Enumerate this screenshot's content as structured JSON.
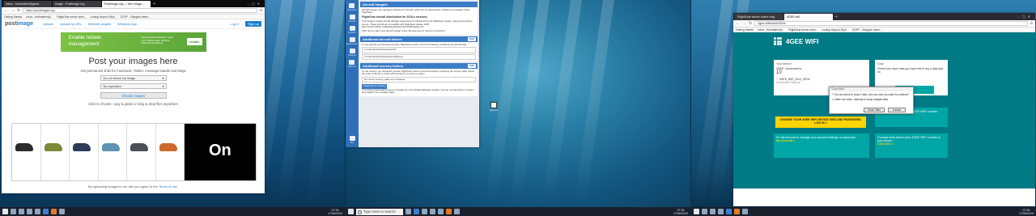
{
  "screen1": {
    "tabs": [
      "Inbox - fredmather@gmai...",
      "Image - Postimage.org",
      "Postimage.org — free image...",
      "+"
    ],
    "url": "https://postimages.org",
    "bookmarks": [
      "Getting Started",
      "Inbox - fredmather@...",
      "FlightGear server onlin...",
      "Lookup Airport | Biyli...",
      "EGPF - Glasgow Intern..."
    ],
    "header": {
      "logo_a": "post",
      "logo_b": "image",
      "nav": [
        "Upload",
        "Upload by URL",
        "Website plugins",
        "Windows App"
      ],
      "login": "Log in",
      "signup": "Sign up"
    },
    "ad": {
      "headline": "Enable rebate management",
      "body": "Cloud-hosted software. Track your rebate deals. Achieve financial compliance.",
      "brand": "enable"
    },
    "title": "Post your images here",
    "subtitle": "Get permanent links for Facebook, Twitter, message boards and blogs",
    "resize": "Do not resize my image",
    "expiry": "No expiration",
    "choose": "Choose images",
    "hint": "Click to choose, copy & paste or drag & drop files anywhere",
    "brand_logo": "On",
    "footer_a": "By uploading images to our site you agree to the",
    "footer_b": "Terms of use."
  },
  "screen2": {
    "sidebar": [
      "Summary",
      "Aircraft",
      "Location",
      "Environment",
      "Settings",
      "Add-ons"
    ],
    "sidebar_bottom": "Fly!",
    "aircraft": {
      "header": "Aircraft hangars",
      "intro": "Aircraft hangars are managed collections of aircraft, which can be downloaded, installed and updated inside FlightGear.",
      "dist_title": "FlightGear aircraft distribution for 2018.x versions",
      "dist_text": "This hangar includes aircraft officially supported and maintained by the FlightGear project, using a hand-drawn license. These aircraft are compatible with FlightGear release 2018.",
      "dist_url": "http://mirrors.ibiblio.org/flightgear/ftp/Aircraft-2018/catalog.xml",
      "dist_hint": "Click here to add a new aircraft hangar. (Note this assumes an Internet connection)"
    },
    "folders": {
      "header": "Additional aircraft folders",
      "add": "Add",
      "text": "To use aircraft you download yourself, FlightGear needs to know the folder(s) containing the aircraft data.",
      "paths": [
        "C:/Users/fredm/Desktop/aircraft",
        "C:/Users/fredm/Desktop/Aircraft/Navys"
      ]
    },
    "scenery": {
      "header": "Additional scenery folders",
      "add": "Add",
      "text": "To use scenery you download yourself, FlightGear needs to know the folders containing the scenery data. Adjust the order of the list to control which scenery is used in a region.",
      "none": "No custom scenery paths are configured.",
      "install_btn": "Install add-on scenery",
      "install_text": "If you have downloaded scenery manually from the official FlightGear website, you can use this button to extract and install it into a suitable folder."
    },
    "desktop_icon": "fgfs.exe",
    "search_placeholder": "Type here to search"
  },
  "screen3": {
    "tabs": [
      "FlightGear server online map",
      "4GEE wifi",
      "+"
    ],
    "url": "4gee.wifi/web/#/4Gee",
    "bookmarks": [
      "Getting Started",
      "Inbox - fredmather@...",
      "FlightGear server onlin...",
      "Lookup Airport | Biyli...",
      "EGPF - Glasgow Intern..."
    ],
    "logo": "4GEE WIFI",
    "device": {
      "title": "Your device",
      "name": "4GEE",
      "connected_label": "Connected to:",
      "connected_count": "10",
      "network": "4GEE_WiFi_3414_5GHz",
      "sub": "Connected Devices:"
    },
    "data": {
      "title": "Data",
      "text": "Check how much data you have left or buy a data add-on",
      "cta": "CK HERE >"
    },
    "change_ssid": "CHANGE YOUR 4GEE WIFI DEVICE SSID AND PASSWORD. LOG IN >",
    "sms_top": "Forward texts sent to your 4GEE WIFI number.",
    "account": {
      "text": "Do My Account to manage your account settings or payments.",
      "link": "My Account >"
    },
    "forward": {
      "text": "Forward texts sent to your 4GEE WIFI number to your phone.",
      "link": "Click here >"
    },
    "dialog": {
      "title": "Close tabs?",
      "text": "You are about to close 2 tabs. Are you sure you want to continue?",
      "check": "Warn me when I attempt to close multiple tabs",
      "ok": "Close Tabs",
      "cancel": "Cancel"
    }
  },
  "clock": {
    "time": "07:35",
    "date": "17/06/2019"
  },
  "colors": {
    "ee_teal": "#007b85",
    "ee_yellow": "#ffd300",
    "fg_blue": "#2f6fb8",
    "pi_blue": "#1d7fcf"
  }
}
